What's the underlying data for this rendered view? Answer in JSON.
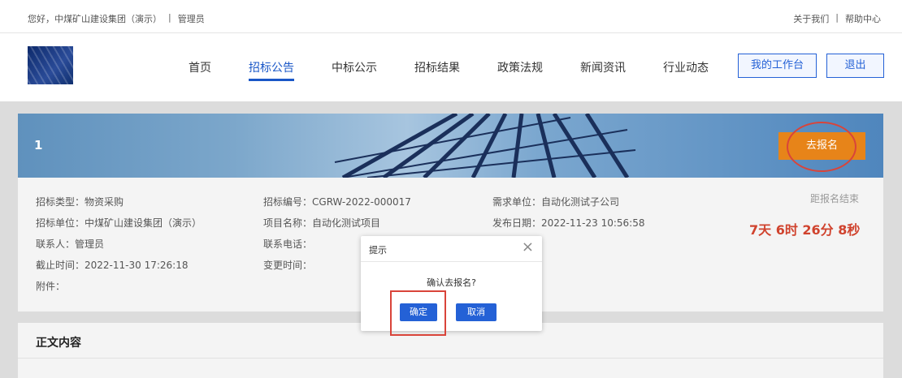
{
  "topbar": {
    "greeting": "您好，中煤矿山建设集团（演示）",
    "separator": "|",
    "role": "管理员",
    "about": "关于我们",
    "help": "帮助中心"
  },
  "nav": {
    "items": [
      "首页",
      "招标公告",
      "中标公示",
      "招标结果",
      "政策法规",
      "新闻资讯",
      "行业动态"
    ],
    "active_index": 1,
    "workspace": "我的工作台",
    "logout": "退出"
  },
  "banner": {
    "title": "1",
    "signup": "去报名"
  },
  "info": {
    "col1": [
      {
        "label": "招标类型：",
        "value": "物资采购"
      },
      {
        "label": "招标单位：",
        "value": "中煤矿山建设集团（演示）"
      },
      {
        "label": "联系人：",
        "value": "管理员"
      },
      {
        "label": "截止时间：",
        "value": "2022-11-30 17:26:18"
      },
      {
        "label": "附件：",
        "value": ""
      }
    ],
    "col2": [
      {
        "label": "招标编号：",
        "value": "CGRW-2022-000017"
      },
      {
        "label": "项目名称：",
        "value": "自动化测试项目"
      },
      {
        "label": "联系电话：",
        "value": ""
      },
      {
        "label": "变更时间：",
        "value": ""
      }
    ],
    "col3": [
      {
        "label": "需求单位：",
        "value": "自动化测试子公司"
      },
      {
        "label": "发布日期：",
        "value": "2022-11-23 10:56:58"
      }
    ],
    "countdown_label": "距报名结束",
    "countdown": "7天 6时 26分 8秒"
  },
  "section": {
    "title": "正文内容"
  },
  "dialog": {
    "title": "提示",
    "close": "×",
    "message": "确认去报名?",
    "ok": "确定",
    "cancel": "取消"
  }
}
